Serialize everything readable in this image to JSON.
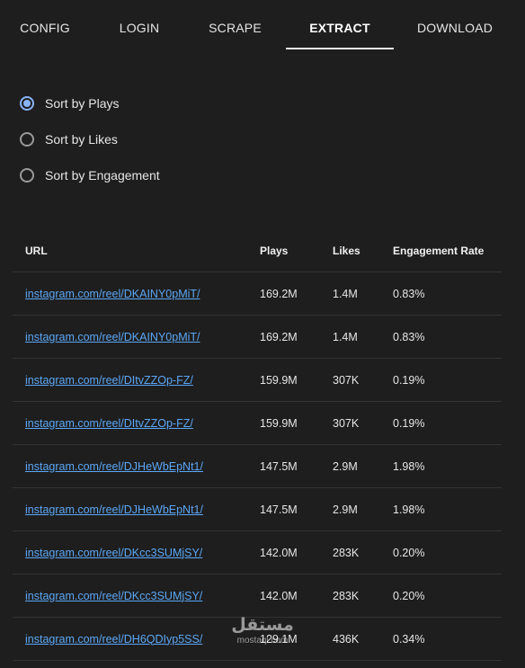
{
  "tabs": [
    {
      "label": "CONFIG"
    },
    {
      "label": "LOGIN"
    },
    {
      "label": "SCRAPE"
    },
    {
      "label": "EXTRACT",
      "active": true
    },
    {
      "label": "DOWNLOAD"
    }
  ],
  "sort_options": [
    {
      "label": "Sort by Plays",
      "checked": true
    },
    {
      "label": "Sort by Likes",
      "checked": false
    },
    {
      "label": "Sort by Engagement",
      "checked": false
    }
  ],
  "table": {
    "headers": {
      "url": "URL",
      "plays": "Plays",
      "likes": "Likes",
      "engagement": "Engagement Rate"
    },
    "rows": [
      {
        "url": "instagram.com/reel/DKAINY0pMiT/",
        "plays": "169.2M",
        "likes": "1.4M",
        "engagement": "0.83%"
      },
      {
        "url": "instagram.com/reel/DKAINY0pMiT/",
        "plays": "169.2M",
        "likes": "1.4M",
        "engagement": "0.83%"
      },
      {
        "url": "instagram.com/reel/DItvZZOp-FZ/",
        "plays": "159.9M",
        "likes": "307K",
        "engagement": "0.19%"
      },
      {
        "url": "instagram.com/reel/DItvZZOp-FZ/",
        "plays": "159.9M",
        "likes": "307K",
        "engagement": "0.19%"
      },
      {
        "url": "instagram.com/reel/DJHeWbEpNt1/",
        "plays": "147.5M",
        "likes": "2.9M",
        "engagement": "1.98%"
      },
      {
        "url": "instagram.com/reel/DJHeWbEpNt1/",
        "plays": "147.5M",
        "likes": "2.9M",
        "engagement": "1.98%"
      },
      {
        "url": "instagram.com/reel/DKcc3SUMjSY/",
        "plays": "142.0M",
        "likes": "283K",
        "engagement": "0.20%"
      },
      {
        "url": "instagram.com/reel/DKcc3SUMjSY/",
        "plays": "142.0M",
        "likes": "283K",
        "engagement": "0.20%"
      },
      {
        "url": "instagram.com/reel/DH6QDIyp5SS/",
        "plays": "129.1M",
        "likes": "436K",
        "engagement": "0.34%"
      }
    ]
  },
  "watermark": {
    "arabic": "مستقل",
    "latin": "mostaql.com"
  }
}
